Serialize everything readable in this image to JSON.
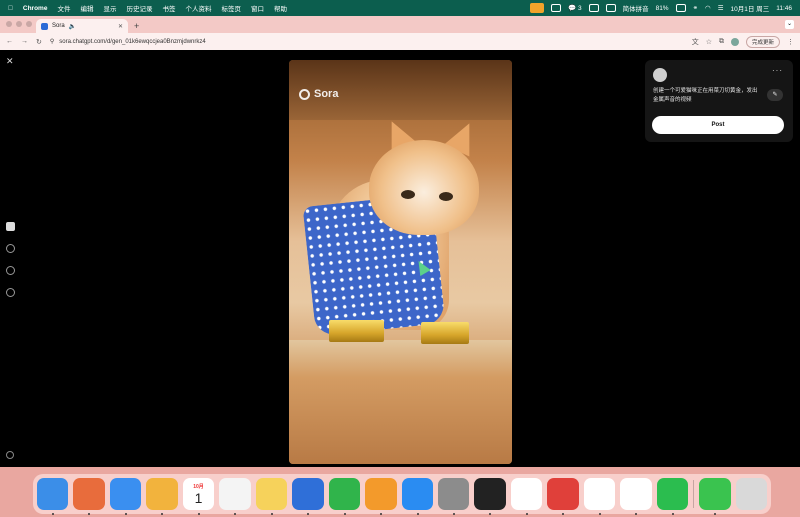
{
  "menubar": {
    "app": "Chrome",
    "items": [
      "文件",
      "编辑",
      "显示",
      "历史记录",
      "书签",
      "个人资料",
      "标签页",
      "窗口",
      "帮助"
    ],
    "status": {
      "wechat_count": "3",
      "input_method": "简体拼音",
      "battery": "81%",
      "datetime": "10月1日 周三",
      "time": "11:46"
    }
  },
  "browser": {
    "tab_title": "Sora",
    "url": "sora.chatgpt.com/d/gen_01k6ewqccjea0Bnzmjdwnrkz4",
    "update_button": "完成更新"
  },
  "video": {
    "watermark": "Sora"
  },
  "panel": {
    "more": "···",
    "prompt": "创建一个可爱猫咪正在用菜刀切黄金，发出金属声音的视频",
    "post_button": "Post"
  },
  "dock": {
    "calendar_month": "10月",
    "calendar_day": "1",
    "apps": [
      {
        "name": "finder",
        "color": "#3b8ee8"
      },
      {
        "name": "launchpad",
        "color": "#e86c3c"
      },
      {
        "name": "mail",
        "color": "#3a8ff0"
      },
      {
        "name": "photos",
        "color": "#f2b33d"
      },
      {
        "name": "calendar",
        "color": "#ffffff"
      },
      {
        "name": "reminders",
        "color": "#f4f4f4"
      },
      {
        "name": "notes",
        "color": "#f6d25b"
      },
      {
        "name": "freeform",
        "color": "#2f6fd8"
      },
      {
        "name": "numbers",
        "color": "#30b44b"
      },
      {
        "name": "pages",
        "color": "#f39a2b"
      },
      {
        "name": "app-store",
        "color": "#2a8cf2"
      },
      {
        "name": "system-settings",
        "color": "#8c8c8c"
      },
      {
        "name": "terminal",
        "color": "#222222"
      },
      {
        "name": "typora",
        "color": "#ffffff"
      },
      {
        "name": "wps",
        "color": "#e0403a"
      },
      {
        "name": "rocket",
        "color": "#ffffff"
      },
      {
        "name": "chrome",
        "color": "#ffffff"
      },
      {
        "name": "wechat",
        "color": "#2bbd4f"
      },
      {
        "name": "messages",
        "color": "#3ac34f"
      },
      {
        "name": "trash",
        "color": "#d9d9d9"
      }
    ]
  }
}
